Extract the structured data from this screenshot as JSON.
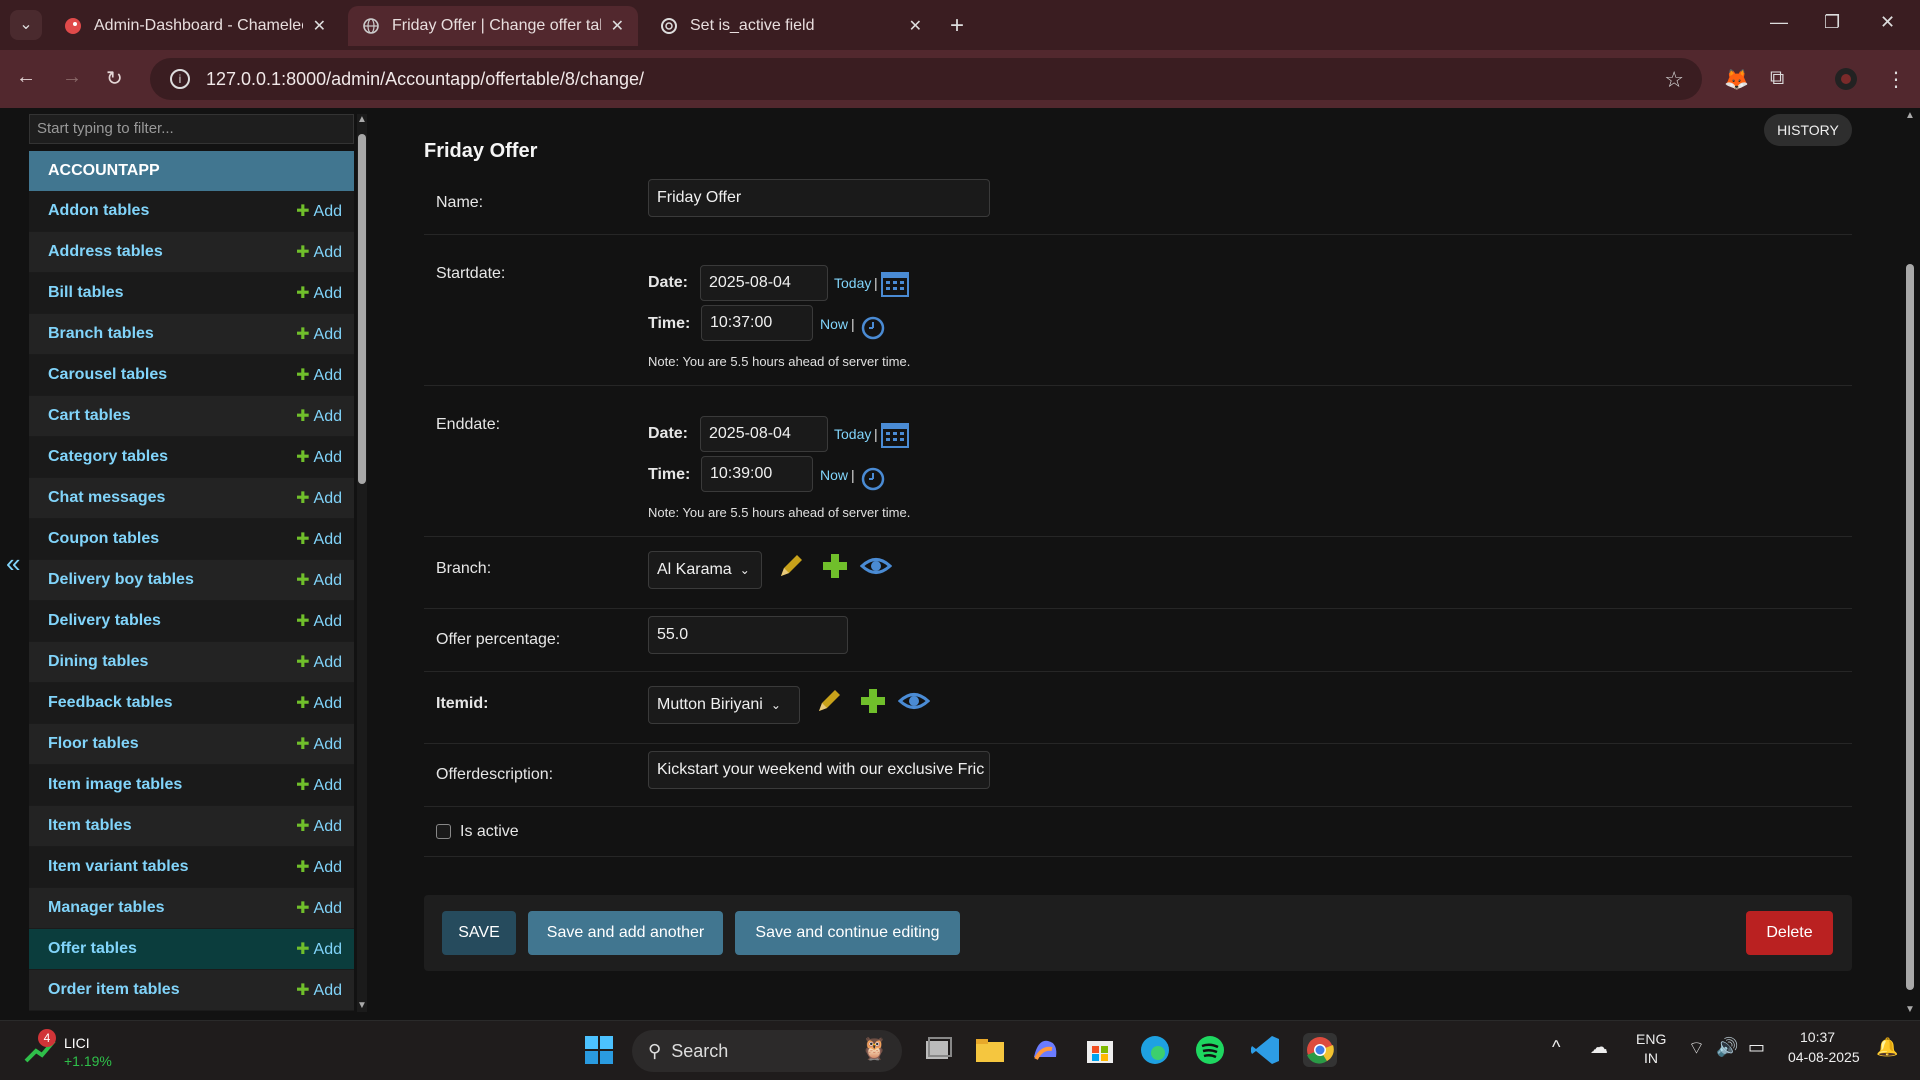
{
  "browser": {
    "tabs": [
      {
        "title": "Admin-Dashboard - Chameleon",
        "active": false
      },
      {
        "title": "Friday Offer | Change offer tabl",
        "active": true
      },
      {
        "title": "Set is_active field",
        "active": false
      }
    ],
    "url": "127.0.0.1:8000/admin/Accountapp/offertable/8/change/"
  },
  "sidebar": {
    "filter_placeholder": "Start typing to filter...",
    "app_caption": "ACCOUNTAPP",
    "add_label": "Add",
    "models": [
      "Addon tables",
      "Address tables",
      "Bill tables",
      "Branch tables",
      "Carousel tables",
      "Cart tables",
      "Category tables",
      "Chat messages",
      "Coupon tables",
      "Delivery boy tables",
      "Delivery tables",
      "Dining tables",
      "Feedback tables",
      "Floor tables",
      "Item image tables",
      "Item tables",
      "Item variant tables",
      "Manager tables",
      "Offer tables",
      "Order item tables"
    ],
    "current_model": "Offer tables",
    "collapse_icon": "«"
  },
  "form": {
    "title": "Friday Offer",
    "history_label": "HISTORY",
    "name": {
      "label": "Name:",
      "value": "Friday Offer"
    },
    "startdate": {
      "label": "Startdate:",
      "date_label": "Date:",
      "date": "2025-08-04",
      "today": "Today",
      "time_label": "Time:",
      "time": "10:37:00",
      "now": "Now",
      "sep": "|",
      "note": "Note: You are 5.5 hours ahead of server time."
    },
    "enddate": {
      "label": "Enddate:",
      "date_label": "Date:",
      "date": "2025-08-04",
      "today": "Today",
      "time_label": "Time:",
      "time": "10:39:00",
      "now": "Now",
      "sep": "|",
      "note": "Note: You are 5.5 hours ahead of server time."
    },
    "branch": {
      "label": "Branch:",
      "value": "Al Karama"
    },
    "offer_percentage": {
      "label": "Offer percentage:",
      "value": "55.0"
    },
    "itemid": {
      "label": "Itemid:",
      "value": "Mutton Biriyani"
    },
    "offerdescription": {
      "label": "Offerdescription:",
      "value": "Kickstart your weekend with our exclusive Fric"
    },
    "is_active": {
      "label": "Is active",
      "checked": false
    }
  },
  "actions": {
    "save": "SAVE",
    "save_add_another": "Save and add another",
    "save_continue": "Save and continue editing",
    "delete": "Delete"
  },
  "colors": {
    "primary": "#417690",
    "delete": "#ba2121",
    "link": "#81d4fa",
    "add_green": "#70bf2b"
  },
  "taskbar": {
    "stock_name": "LICI",
    "stock_change": "+1.19%",
    "stock_badge": "4",
    "search_label": "Search",
    "lang_top": "ENG",
    "lang_bottom": "IN",
    "time": "10:37",
    "date": "04-08-2025"
  }
}
